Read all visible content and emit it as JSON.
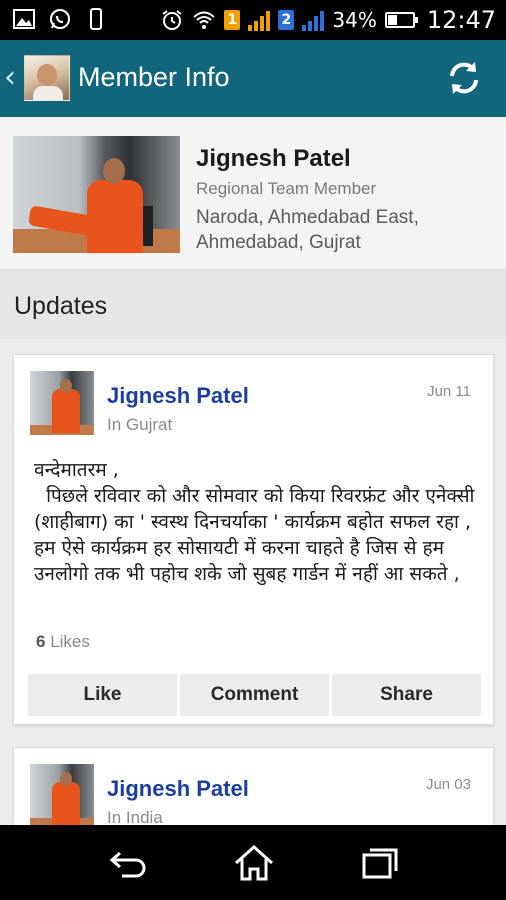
{
  "status_bar": {
    "sim1": "1",
    "sim2": "2",
    "battery": "34%",
    "battery_level": 0.34,
    "time": "12:47"
  },
  "action_bar": {
    "back_icon": "chevron-left-icon",
    "title": "Member Info",
    "refresh_icon": "refresh-icon",
    "color": "#11667b"
  },
  "profile": {
    "name": "Jignesh Patel",
    "role": "Regional Team Member",
    "location": "Naroda, Ahmedabad East, Ahmedabad, Gujrat"
  },
  "updates": {
    "title": "Updates",
    "posts": [
      {
        "author": "Jignesh Patel",
        "place": "In Gujrat",
        "date": "Jun 11",
        "text": "वन्देमातरम ,\n  पिछले रविवार को और सोमवार को किया रिवरफ्रंट और एनेक्सी (शाहीबाग) का ' स्वस्थ दिनचर्याका ' कार्यक्रम बहोत सफल रहा , हम ऐसे कार्यक्रम हर सोसायटी में करना चाहते है जिस से हम उनलोगो तक भी पहोच शके जो सुबह गार्डन में नहीं आ सकते ,",
        "likes_count": "6",
        "likes_label": "Likes",
        "actions": [
          "Like",
          "Comment",
          "Share"
        ]
      },
      {
        "author": "Jignesh Patel",
        "place": "In India",
        "date": "Jun 03"
      }
    ]
  },
  "nav_bar": {
    "back_icon": "back-icon",
    "home_icon": "home-icon",
    "recents_icon": "recents-icon"
  }
}
